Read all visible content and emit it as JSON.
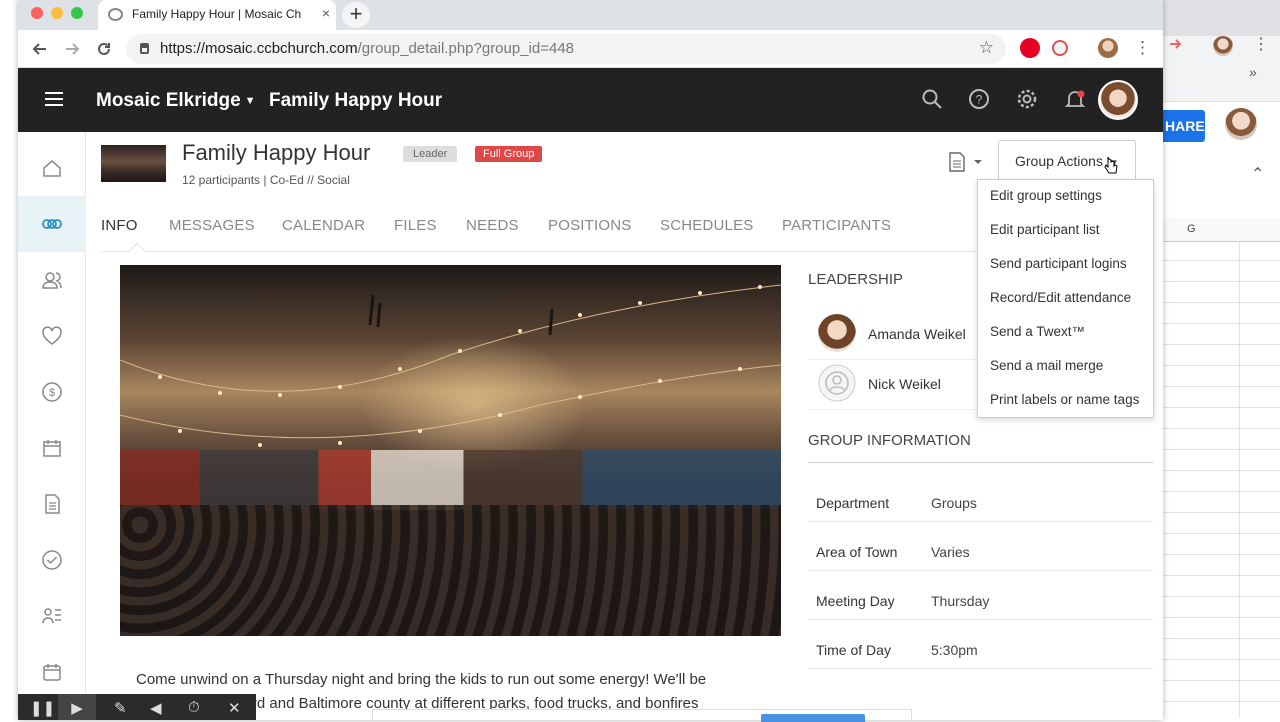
{
  "browser": {
    "tab_title": "Family Happy Hour | Mosaic Ch",
    "new_tab": "+",
    "tab_close": "×",
    "url_host": "https://mosaic.ccbchurch.com",
    "url_path": "/group_detail.php?group_id=448",
    "icons": [
      "back-icon",
      "forward-icon",
      "reload-icon",
      "lock-icon",
      "bookmark-star-icon",
      "pinterest-icon",
      "extension-icon",
      "profile-avatar-icon",
      "kebab-menu-icon"
    ]
  },
  "background_window": {
    "share_label": "HARE",
    "column_header": "G",
    "overflow": "»"
  },
  "app": {
    "campus": "Mosaic Elkridge",
    "title": "Family Happy Hour",
    "header_icons": [
      "search-icon",
      "help-icon",
      "settings-icon",
      "notifications-icon",
      "user-avatar"
    ]
  },
  "sidenav": [
    "home-icon",
    "groups-icon",
    "people-icon",
    "heart-icon",
    "giving-icon",
    "calendar-icon",
    "forms-icon",
    "check-icon",
    "processes-icon",
    "events-icon"
  ],
  "group": {
    "name": "Family Happy Hour",
    "leader_badge": "Leader",
    "full_badge": "Full Group",
    "subtitle": "12 participants | Co-Ed // Social",
    "actions_label": "Group Actions"
  },
  "tabs": [
    "INFO",
    "MESSAGES",
    "CALENDAR",
    "FILES",
    "NEEDS",
    "POSITIONS",
    "SCHEDULES",
    "PARTICIPANTS"
  ],
  "active_tab": "INFO",
  "description": {
    "line1": "Come unwind on a Thursday night and bring the kids to run out some energy! We'll be",
    "line2_start": "out all over Howard and Baltimore county at different parks, food trucks, and bonfires"
  },
  "leadership": {
    "heading": "LEADERSHIP",
    "leaders": [
      {
        "name": "Amanda Weikel"
      },
      {
        "name": "Nick Weikel"
      }
    ]
  },
  "group_info": {
    "heading": "GROUP INFORMATION",
    "rows": [
      {
        "key": "Department",
        "value": "Groups"
      },
      {
        "key": "Area of Town",
        "value": "Varies"
      },
      {
        "key": "Meeting Day",
        "value": "Thursday"
      },
      {
        "key": "Time of Day",
        "value": "5:30pm"
      }
    ]
  },
  "actions_menu": [
    "Edit group settings",
    "Edit participant list",
    "Send participant logins",
    "Record/Edit attendance",
    "Send a Twext™",
    "Send a mail merge",
    "Print labels or name tags"
  ],
  "colors": {
    "app_bar": "#222222",
    "full_badge": "#e04848",
    "active_nav": "#2a8fbf",
    "share_button": "#1a73e8"
  }
}
